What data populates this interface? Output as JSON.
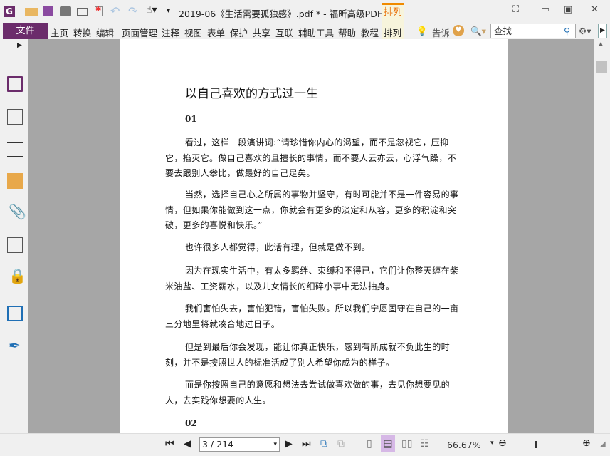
{
  "titlebar": {
    "title": "2019-06《生活需要孤独感》.pdf * - 福昕高级PDF...",
    "context_tab": "排列"
  },
  "menu": {
    "file": "文件",
    "items": [
      "主页",
      "转换",
      "编辑",
      "页面管理",
      "注释",
      "视图",
      "表单",
      "保护",
      "共享",
      "互联",
      "辅助工具",
      "帮助",
      "教程",
      "排列"
    ],
    "tell": "告诉",
    "search_placeholder": "查找"
  },
  "document": {
    "title": "以自己喜欢的方式过一生",
    "section1": "01",
    "paragraphs": [
      "看过，这样一段演讲词:“请珍惜你内心的渴望，而不是忽视它，压抑它，掐灭它。做自己喜欢的且擅长的事情，而不要人云亦云，心浮气躁，不要去跟别人攀比，做最好的自己足矣。",
      "当然，选择自己心之所属的事物并坚守，有时可能并不是一件容易的事情，但如果你能做到这一点，你就会有更多的淡定和从容，更多的积淀和突破，更多的喜悦和快乐。”",
      "也许很多人都觉得，此话有理，但就是做不到。",
      "因为在现实生活中，有太多羁绊、束缚和不得已，它们让你整天缠在柴米油盐、工资薪水，以及儿女情长的细碎小事中无法抽身。",
      "我们害怕失去，害怕犯错，害怕失败。所以我们宁愿固守在自己的一亩三分地里将就凑合地过日子。",
      "但是到最后你会发现，能让你真正快乐，感到有所成就不负此生的时刻，并不是按照世人的标准活成了别人希望你成为的样子。",
      "而是你按照自己的意愿和想法去尝试做喜欢做的事，去见你想要见的人，去实践你想要的人生。"
    ],
    "section2": "02"
  },
  "status": {
    "page": "3 / 214",
    "zoom": "66.67%",
    "zoom_slider_fraction": 0.35
  },
  "colors": {
    "brand": "#6b2c6b",
    "accent": "#f08a00"
  }
}
